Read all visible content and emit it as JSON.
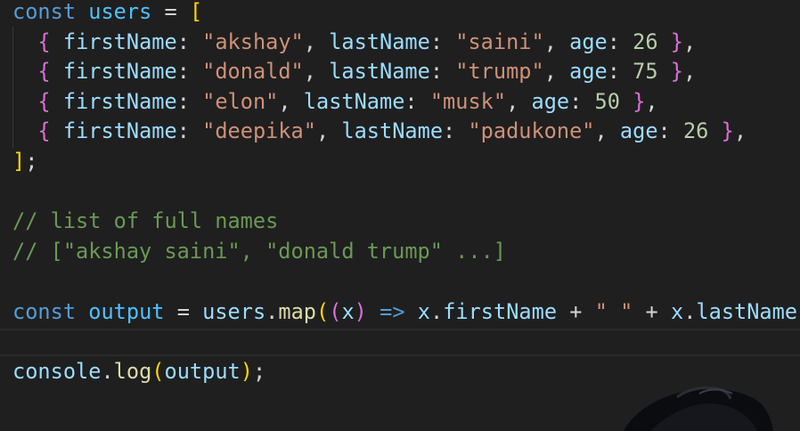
{
  "code": {
    "line1": {
      "kw": "const",
      "name": "users",
      "eq": "=",
      "open": "["
    },
    "users": [
      {
        "first": "\"akshay\"",
        "last": "\"saini\"",
        "age": "26"
      },
      {
        "first": "\"donald\"",
        "last": "\"trump\"",
        "age": "75"
      },
      {
        "first": "\"elon\"",
        "last": "\"musk\"",
        "age": "50"
      },
      {
        "first": "\"deepika\"",
        "last": "\"padukone\"",
        "age": "26"
      }
    ],
    "keys": {
      "first": "firstName",
      "last": "lastName",
      "age": "age"
    },
    "line6": {
      "close": "]",
      "semi": ";"
    },
    "comment1": "// list of full names",
    "comment2": "// [\"akshay saini\", \"donald trump\" ...]",
    "line10": {
      "kw": "const",
      "name": "output",
      "eq": "=",
      "obj": "users",
      "method": "map",
      "param": "x",
      "arrow": "=>",
      "param2": "x",
      "prop1": "firstName",
      "plus": "+",
      "space_str": "\" \"",
      "param3": "x",
      "prop2": "lastName"
    },
    "line12": {
      "obj": "console",
      "method": "log",
      "arg": "output"
    }
  },
  "colors": {
    "background": "#1f1f1f",
    "keyword": "#569cd6",
    "string": "#ce9178",
    "number": "#b5cea8",
    "comment": "#6a9955",
    "property": "#9cdcfe",
    "function": "#dcdcaa"
  }
}
